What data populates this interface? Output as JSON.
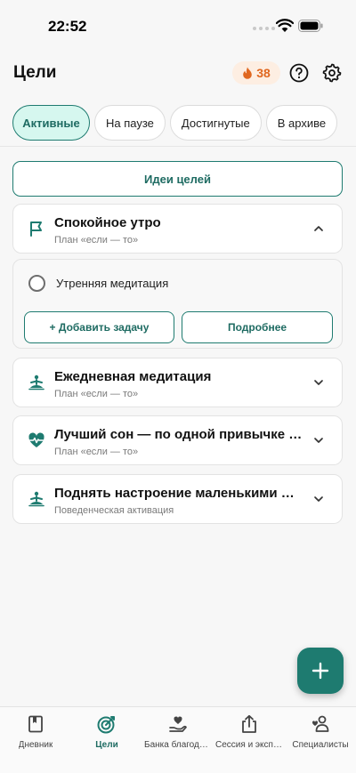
{
  "status_bar": {
    "time": "22:52"
  },
  "header": {
    "title": "Цели",
    "streak_count": "38"
  },
  "tabs": [
    {
      "label": "Активные",
      "active": true
    },
    {
      "label": "На паузе",
      "active": false
    },
    {
      "label": "Достигнутые",
      "active": false
    },
    {
      "label": "В архиве",
      "active": false
    }
  ],
  "ideas_button": "Идеи целей",
  "goals": [
    {
      "title": "Спокойное утро",
      "subtitle": "План «если — то»",
      "icon": "flag-icon",
      "expanded": true
    },
    {
      "title": "Ежедневная медитация",
      "subtitle": "План «если — то»",
      "icon": "meditation-icon",
      "expanded": false
    },
    {
      "title": "Лучший сон — по одной привычке за раз",
      "subtitle": "План «если — то»",
      "icon": "heartbeat-icon",
      "expanded": false
    },
    {
      "title": "Поднять настроение маленькими делами",
      "subtitle": "Поведенческая активация",
      "icon": "meditation-icon",
      "expanded": false
    }
  ],
  "expanded_goal": {
    "task": "Утренняя медитация",
    "add_task_label": "+ Добавить задачу",
    "details_label": "Подробнее"
  },
  "bottom_nav": [
    {
      "label": "Дневник",
      "icon": "journal-icon",
      "active": false
    },
    {
      "label": "Цели",
      "icon": "target-icon",
      "active": true
    },
    {
      "label": "Банка благодарности",
      "icon": "gratitude-jar-icon",
      "active": false
    },
    {
      "label": "Сессия и экспорт",
      "icon": "share-icon",
      "active": false
    },
    {
      "label": "Специалисты",
      "icon": "specialists-icon",
      "active": false
    }
  ],
  "colors": {
    "accent": "#1e7b70",
    "accent_light": "#d6f7ef",
    "streak": "#e0671f",
    "streak_bg": "#fdeee2"
  }
}
